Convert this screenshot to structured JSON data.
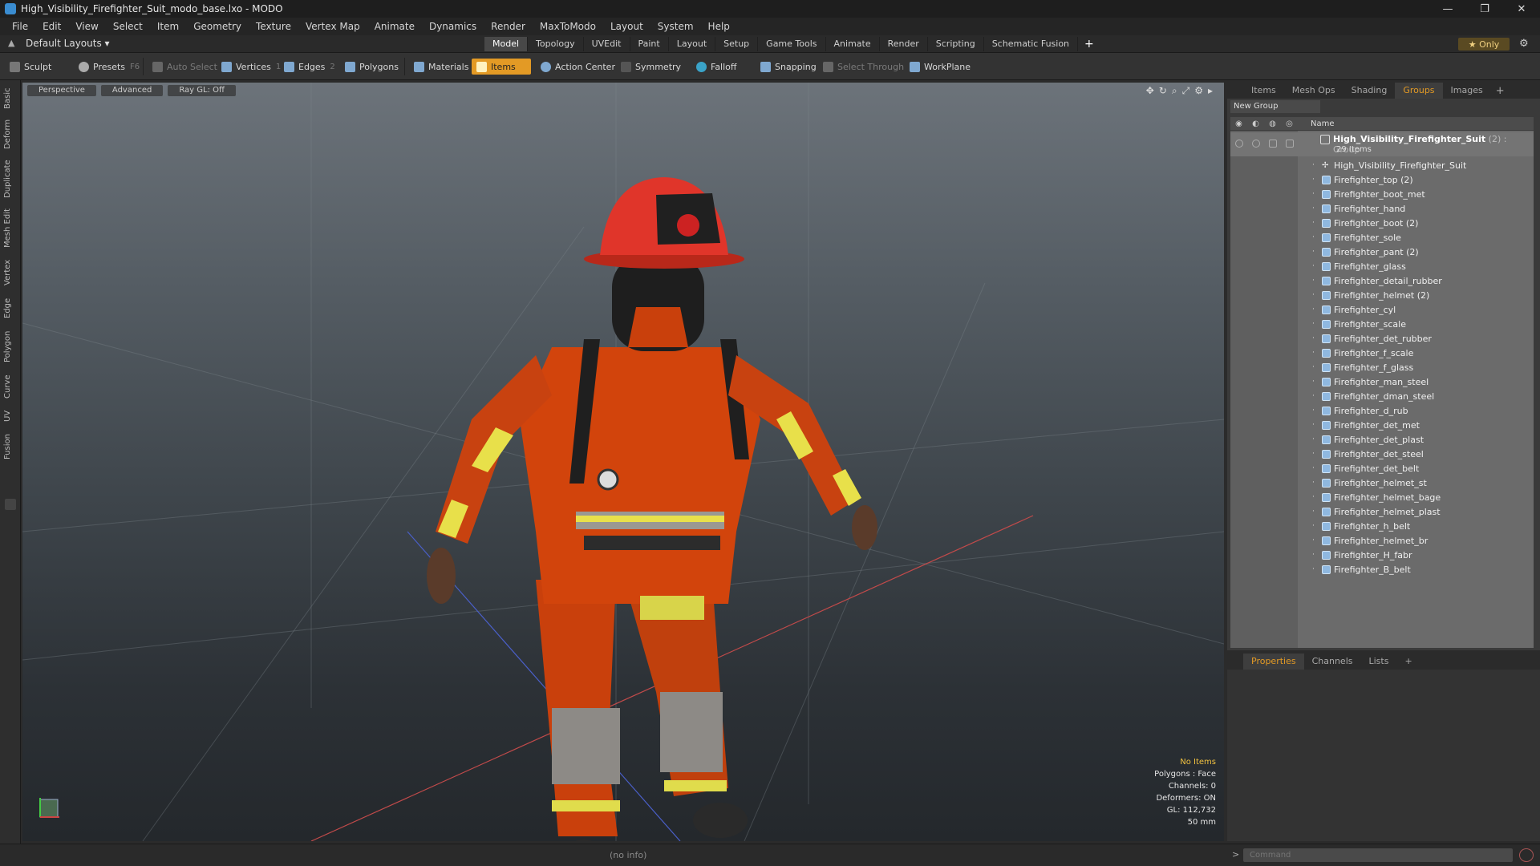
{
  "window": {
    "title": "High_Visibility_Firefighter_Suit_modo_base.lxo - MODO",
    "controls": [
      "—",
      "❐",
      "✕"
    ]
  },
  "menu": [
    "File",
    "Edit",
    "View",
    "Select",
    "Item",
    "Geometry",
    "Texture",
    "Vertex Map",
    "Animate",
    "Dynamics",
    "Render",
    "MaxToModo",
    "Layout",
    "System",
    "Help"
  ],
  "layout_bar": {
    "layout_select": "Default Layouts ▾",
    "tabs": [
      "Model",
      "Topology",
      "UVEdit",
      "Paint",
      "Layout",
      "Setup",
      "Game Tools",
      "Animate",
      "Render",
      "Scripting",
      "Schematic Fusion"
    ],
    "active_tab": "Model",
    "plus": "+",
    "only_label": "★  Only"
  },
  "toolbar": {
    "sculpt": "Sculpt",
    "presets": "Presets",
    "presets_key": "F6",
    "auto_select": "Auto Select",
    "vertices": "Vertices",
    "vertices_count": "1",
    "edges": "Edges",
    "edges_count": "2",
    "polygons": "Polygons",
    "materials": "Materials",
    "items": "Items",
    "action_center": "Action Center",
    "symmetry": "Symmetry",
    "falloff": "Falloff",
    "snapping": "Snapping",
    "select_through": "Select Through",
    "workplane": "WorkPlane"
  },
  "left_tabs": [
    "Basic",
    "Deform",
    "Duplicate",
    "Mesh Edit",
    "Vertex",
    "Edge",
    "Polygon",
    "Curve",
    "UV",
    "Fusion"
  ],
  "viewport": {
    "perspective": "Perspective",
    "advanced": "Advanced",
    "raygl": "Ray GL: Off",
    "info": {
      "no_items": "No Items",
      "polygons": "Polygons : Face",
      "channels": "Channels: 0",
      "deformers": "Deformers: ON",
      "gl": "GL: 112,732",
      "size": "50 mm"
    }
  },
  "right_panel": {
    "tabs": [
      "Items",
      "Mesh Ops",
      "Shading",
      "Groups",
      "Images"
    ],
    "active_tab": "Groups",
    "new_group": "New Group",
    "col_name": "Name",
    "group": {
      "name": "High_Visibility_Firefighter_Suit",
      "count": " (2) : Group",
      "sub": "29 Items"
    },
    "items": [
      "High_Visibility_Firefighter_Suit",
      "Firefighter_top (2)",
      "Firefighter_boot_met",
      "Firefighter_hand",
      "Firefighter_boot (2)",
      "Firefighter_sole",
      "Firefighter_pant (2)",
      "Firefighter_glass",
      "Firefighter_detail_rubber",
      "Firefighter_helmet (2)",
      "Firefighter_cyl",
      "Firefighter_scale",
      "Firefighter_det_rubber",
      "Firefighter_f_scale",
      "Firefighter_f_glass",
      "Firefighter_man_steel",
      "Firefighter_dman_steel",
      "Firefighter_d_rub",
      "Firefighter_det_met",
      "Firefighter_det_plast",
      "Firefighter_det_steel",
      "Firefighter_det_belt",
      "Firefighter_helmet_st",
      "Firefighter_helmet_bage",
      "Firefighter_helmet_plast",
      "Firefighter_h_belt",
      "Firefighter_helmet_br",
      "Firefighter_H_fabr",
      "Firefighter_B_belt"
    ]
  },
  "properties_panel": {
    "tabs": [
      "Properties",
      "Channels",
      "Lists"
    ],
    "active_tab": "Properties",
    "plus": "+"
  },
  "status": {
    "info": "(no info)",
    "command_placeholder": "Command",
    "prompt": ">"
  },
  "colors": {
    "accent": "#e39a25",
    "suit": "#d2440c",
    "reflective": "#e8e04a"
  }
}
